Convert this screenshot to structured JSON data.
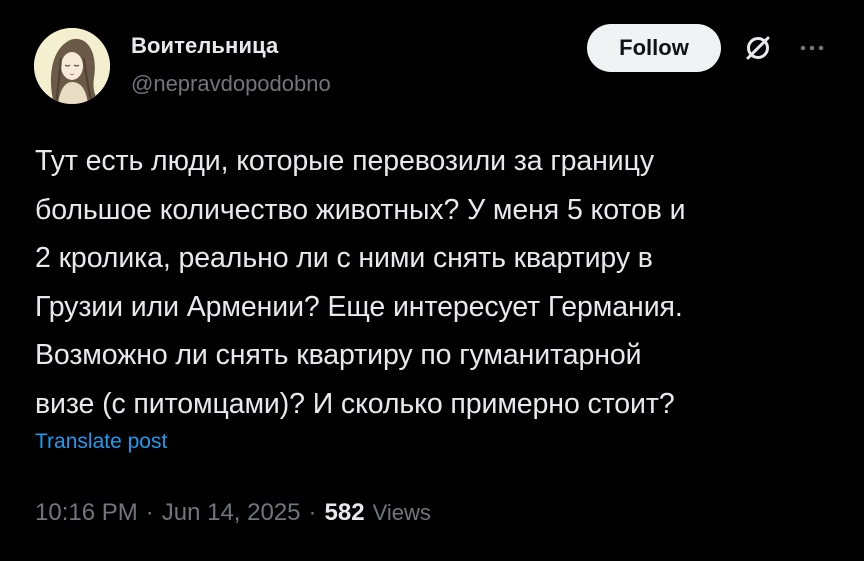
{
  "author": {
    "display_name": "Воительница",
    "handle": "@nepravdopodobno"
  },
  "actions": {
    "follow_label": "Follow",
    "grok_icon": "slashed-circle-icon",
    "more_icon": "ellipsis-icon"
  },
  "post": {
    "text": "Тут есть люди, которые перевозили за границу\nбольшое количество животных? У меня 5 котов и\n2 кролика, реально ли с ними снять квартиру в\nГрузии или Армении? Еще интересует Германия.\nВозможно ли снять квартиру по гуманитарной\nвизе (с питомцами)? И сколько примерно стоит?",
    "translate_label": "Translate post"
  },
  "meta": {
    "time": "10:16 PM",
    "separator": "·",
    "date": "Jun 14, 2025",
    "views_count": "582",
    "views_label": "Views"
  },
  "colors": {
    "background": "#000000",
    "text_primary": "#e7e9ea",
    "text_secondary": "#71767b",
    "link": "#1d9bf0",
    "follow_bg": "#eff3f4"
  }
}
